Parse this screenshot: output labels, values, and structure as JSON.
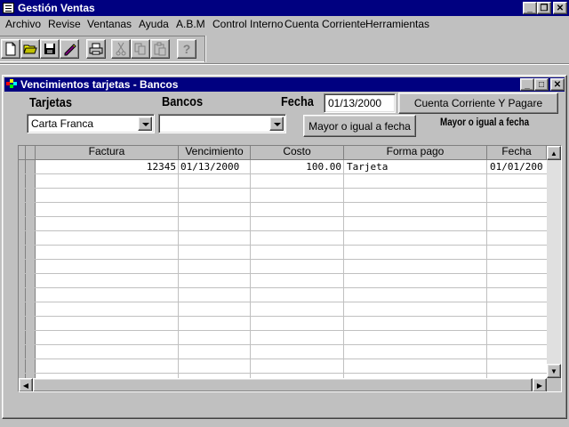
{
  "app": {
    "title": "Gestión Ventas"
  },
  "menu": {
    "items": [
      "Archivo",
      "Revise",
      "Ventanas",
      "Ayuda",
      "A.B.M",
      "Control Interno",
      "Cuenta Corriente",
      "Herramientas"
    ]
  },
  "toolbar": {
    "icons": [
      "new-file-icon",
      "open-folder-icon",
      "save-disk-icon",
      "edit-pencil-icon",
      "print-icon",
      "cut-icon",
      "copy-icon",
      "paste-icon",
      "help-icon"
    ]
  },
  "window": {
    "title": "Vencimientos tarjetas - Bancos"
  },
  "form": {
    "tarjetas_label": "Tarjetas",
    "tarjetas_value": "Carta Franca",
    "bancos_label": "Bancos",
    "bancos_value": "",
    "fecha_label": "Fecha",
    "fecha_value": "01/13/2000",
    "cuenta_button": "Cuenta Corriente Y Pagare",
    "mayor_button": "Mayor o igual a fecha",
    "mayor_note": "Mayor o igual a fecha"
  },
  "grid": {
    "columns": [
      "Factura",
      "Vencimiento",
      "Costo",
      "Forma pago",
      "Fecha"
    ],
    "rows": [
      {
        "factura": "12345",
        "vencimiento": "01/13/2000",
        "costo": "100.00",
        "forma_pago": "Tarjeta",
        "fecha": "01/01/200"
      }
    ]
  },
  "colors": {
    "titlebar": "#000080",
    "face": "#c0c0c0"
  }
}
